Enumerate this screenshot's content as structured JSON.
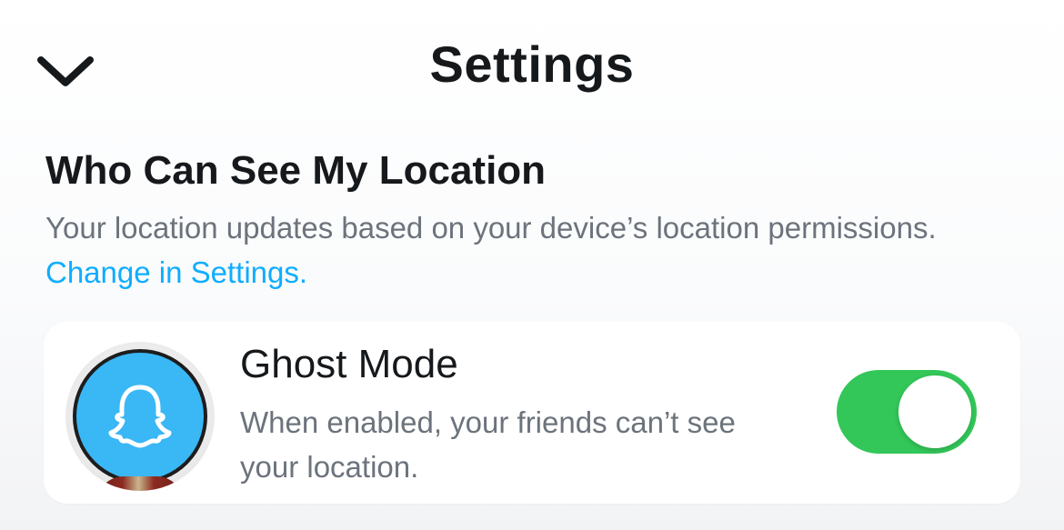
{
  "header": {
    "title": "Settings",
    "back_icon": "chevron-down-icon"
  },
  "location_section": {
    "title": "Who Can See My Location",
    "description": "Your location updates based on your device’s location permissions.",
    "link_text": "Change in Settings.",
    "link_color": "#0fadff"
  },
  "ghost_mode": {
    "title": "Ghost Mode",
    "description": "When enabled, your friends can’t see your location.",
    "avatar_icon": "ghost-icon",
    "enabled": true,
    "toggle_color": "#33c759"
  }
}
